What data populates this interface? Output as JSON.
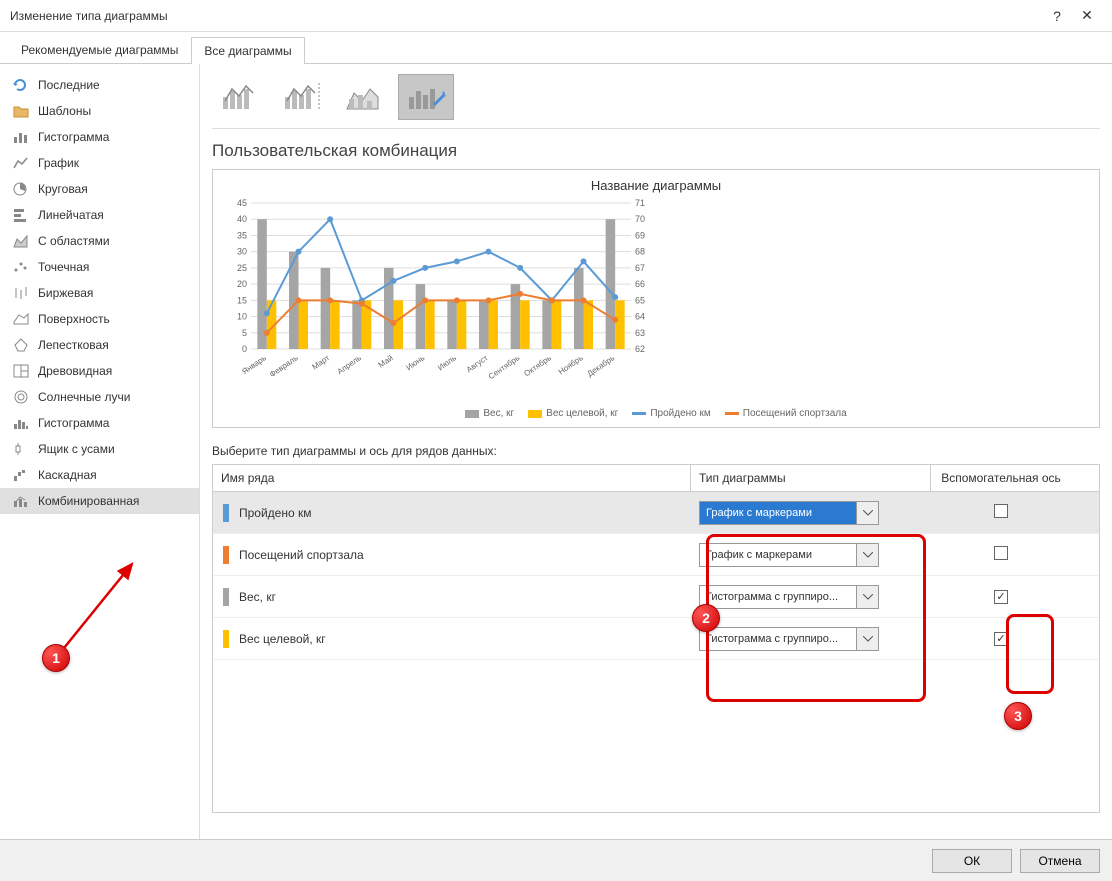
{
  "window": {
    "title": "Изменение типа диаграммы"
  },
  "tabs": {
    "recommended": "Рекомендуемые диаграммы",
    "all": "Все диаграммы"
  },
  "sidebar": {
    "items": [
      {
        "label": "Последние"
      },
      {
        "label": "Шаблоны"
      },
      {
        "label": "Гистограмма"
      },
      {
        "label": "График"
      },
      {
        "label": "Круговая"
      },
      {
        "label": "Линейчатая"
      },
      {
        "label": "С областями"
      },
      {
        "label": "Точечная"
      },
      {
        "label": "Биржевая"
      },
      {
        "label": "Поверхность"
      },
      {
        "label": "Лепестковая"
      },
      {
        "label": "Древовидная"
      },
      {
        "label": "Солнечные лучи"
      },
      {
        "label": "Гистограмма"
      },
      {
        "label": "Ящик с усами"
      },
      {
        "label": "Каскадная"
      },
      {
        "label": "Комбинированная"
      }
    ]
  },
  "section_title": "Пользовательская комбинация",
  "chart_title": "Название диаграммы",
  "instruction": "Выберите тип диаграммы и ось для рядов данных:",
  "grid_headers": {
    "name": "Имя ряда",
    "type": "Тип диаграммы",
    "axis": "Вспомогательная ось"
  },
  "series_rows": [
    {
      "name": "Пройдено км",
      "type": "График с маркерами",
      "color": "#5B9BD5",
      "checked": false,
      "highlight": true,
      "selected": true
    },
    {
      "name": "Посещений спортзала",
      "type": "График с маркерами",
      "color": "#ED7D31",
      "checked": false,
      "highlight": false,
      "selected": false
    },
    {
      "name": "Вес, кг",
      "type": "Гистограмма с группиро...",
      "color": "#A5A5A5",
      "checked": true,
      "highlight": false,
      "selected": false
    },
    {
      "name": "Вес целевой, кг",
      "type": "Гистограмма с группиро...",
      "color": "#FFC000",
      "checked": true,
      "highlight": false,
      "selected": false
    }
  ],
  "legend": {
    "s1": "Вес, кг",
    "s2": "Вес целевой, кг",
    "s3": "Пройдено км",
    "s4": "Посещений спортзала"
  },
  "footer": {
    "ok": "ОК",
    "cancel": "Отмена"
  },
  "callouts": {
    "c1": "1",
    "c2": "2",
    "c3": "3"
  },
  "chart_data": {
    "type": "combo",
    "title": "Название диаграммы",
    "categories": [
      "Январь",
      "Февраль",
      "Март",
      "Апрель",
      "Май",
      "Июнь",
      "Июль",
      "Август",
      "Сентябрь",
      "Октябрь",
      "Ноябрь",
      "Декабрь"
    ],
    "y1": {
      "label": "",
      "ticks": [
        0,
        5,
        10,
        15,
        20,
        25,
        30,
        35,
        40,
        45
      ]
    },
    "y2": {
      "label": "",
      "ticks": [
        62,
        63,
        64,
        65,
        66,
        67,
        68,
        69,
        70,
        71
      ]
    },
    "series": [
      {
        "name": "Вес, кг",
        "type": "bar",
        "axis": "secondary",
        "color": "#A5A5A5",
        "values": [
          70,
          68,
          67,
          65,
          67,
          66,
          65,
          65,
          66,
          65,
          67,
          70
        ]
      },
      {
        "name": "Вес целевой, кг",
        "type": "bar",
        "axis": "secondary",
        "color": "#FFC000",
        "values": [
          65,
          65,
          65,
          65,
          65,
          65,
          65,
          65,
          65,
          65,
          65,
          65
        ]
      },
      {
        "name": "Пройдено км",
        "type": "line",
        "axis": "primary",
        "color": "#5B9BD5",
        "values": [
          11,
          30,
          40,
          15,
          21,
          25,
          27,
          30,
          25,
          15,
          27,
          16
        ]
      },
      {
        "name": "Посещений спортзала",
        "type": "line",
        "axis": "primary",
        "color": "#ED7D31",
        "values": [
          5,
          15,
          15,
          14,
          8,
          15,
          15,
          15,
          17,
          15,
          15,
          9
        ]
      }
    ]
  }
}
